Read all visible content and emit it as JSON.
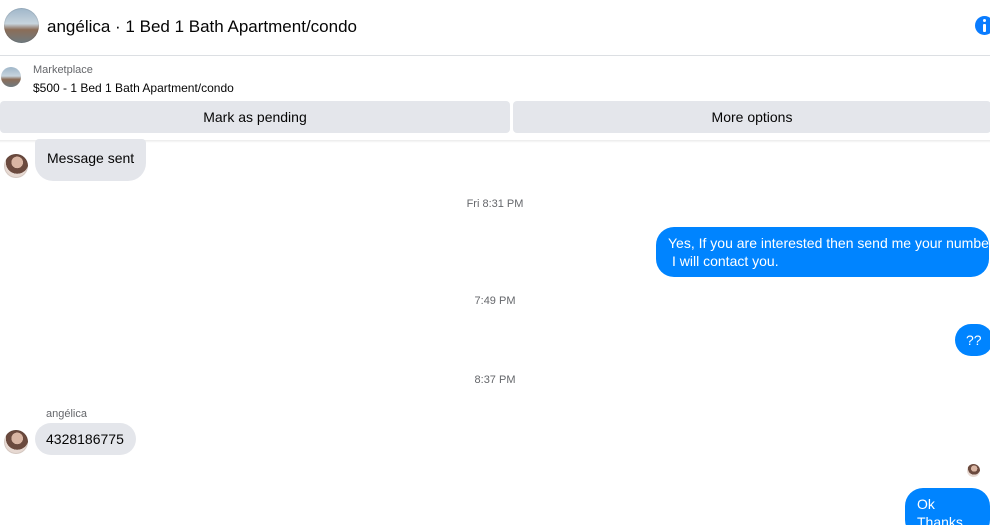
{
  "header": {
    "title": "angélica · 1 Bed 1 Bath Apartment/condo",
    "avatar_icon": "listing-photo",
    "info_icon": "info-icon"
  },
  "marketplace": {
    "label": "Marketplace",
    "listing": "$500 - 1 Bed 1 Bath Apartment/condo"
  },
  "actions": {
    "mark_pending": "Mark as pending",
    "more_options": "More options"
  },
  "conversation": {
    "first_message": "Message sent",
    "time_1": "Fri 8:31 PM",
    "outgoing_1_line1": "Yes, If you are interested then send me your number",
    "outgoing_1_line2": "I will contact you.",
    "time_2": "7:49 PM",
    "outgoing_2": "??",
    "time_3": "8:37 PM",
    "sender_name": "angélica",
    "incoming_number": "4328186775",
    "outgoing_3": "Ok Thanks"
  },
  "colors": {
    "outgoing_bubble": "#0084ff",
    "incoming_bubble": "#e4e6eb",
    "button_bg": "#e4e6eb",
    "accent": "#0a7cff"
  }
}
